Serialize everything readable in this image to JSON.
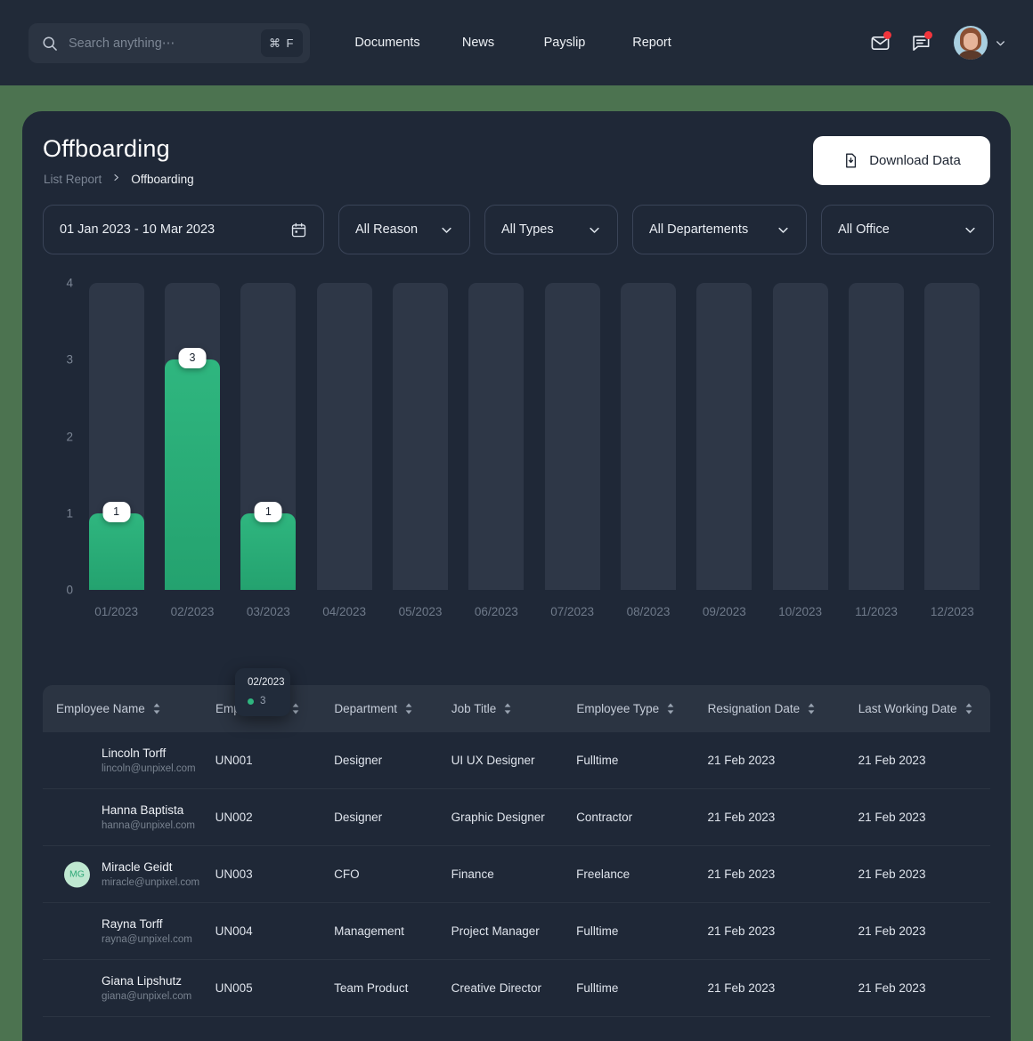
{
  "topbar": {
    "search": {
      "placeholder": "Search anything⋯",
      "value": "",
      "icon": "search-icon",
      "shortcut": "⌘ F"
    },
    "nav": [
      {
        "label": "Documents",
        "name": "documents"
      },
      {
        "label": "News",
        "name": "news"
      },
      {
        "label": "Payslip",
        "name": "payslip"
      },
      {
        "label": "Report",
        "name": "report"
      }
    ],
    "actions": {
      "mail_icon": "mail-icon",
      "chat_icon": "chat-icon",
      "badge_color": "#f2353c",
      "avatar": "user-avatar",
      "chevron": "chevron-down-icon"
    }
  },
  "page": {
    "title": "Offboarding",
    "breadcrumb": {
      "parent": "List Report",
      "separator": "›",
      "current": "Offboarding"
    },
    "download_label": "Download Data",
    "download_icon": "file-download-icon"
  },
  "filters": {
    "date_range": {
      "label": "01 Jan 2023 - 10 Mar 2023",
      "icon": "calendar-icon"
    },
    "reason": {
      "label": "All Reason",
      "icon": "chevron-down-icon"
    },
    "types": {
      "label": "All Types",
      "icon": "chevron-down-icon"
    },
    "departments": {
      "label": "All Departements",
      "icon": "chevron-down-icon"
    },
    "office": {
      "label": "All Office",
      "icon": "chevron-down-icon"
    }
  },
  "chart_data": {
    "type": "bar",
    "title": "",
    "xlabel": "",
    "ylabel": "",
    "categories": [
      "01/2023",
      "02/2023",
      "03/2023",
      "04/2023",
      "05/2023",
      "06/2023",
      "07/2023",
      "08/2023",
      "09/2023",
      "10/2023",
      "11/2023",
      "12/2023"
    ],
    "values": [
      1,
      3,
      1,
      0,
      0,
      0,
      0,
      0,
      0,
      0,
      0,
      0
    ],
    "value_labels": [
      "1",
      "3",
      "1",
      "",
      "",
      "",
      "",
      "",
      "",
      "",
      "",
      ""
    ],
    "ylim": [
      0,
      4
    ],
    "yticks": [
      "0",
      "1",
      "2",
      "3",
      "4"
    ],
    "grid": false,
    "legend": "none",
    "bar_color": "#2fb67f",
    "track_color": "#2e3747",
    "tooltip": {
      "title": "02/2023",
      "value": "3",
      "dot_color": "#2fb67f"
    }
  },
  "table": {
    "columns": [
      {
        "label": "Employee Name",
        "key": "name"
      },
      {
        "label": "Employee ID",
        "key": "id"
      },
      {
        "label": "Department",
        "key": "dept"
      },
      {
        "label": "Job Title",
        "key": "job"
      },
      {
        "label": "Employee Type",
        "key": "type"
      },
      {
        "label": "Resignation Date",
        "key": "resignation"
      },
      {
        "label": "Last Working Date",
        "key": "last"
      }
    ],
    "rows": [
      {
        "name": "Lincoln Torff",
        "email": "lincoln@unpixel.com",
        "initials": "",
        "id": "UN001",
        "dept": "Designer",
        "job": "UI UX Designer",
        "type": "Fulltime",
        "resignation": "21 Feb 2023",
        "last": "21 Feb 2023"
      },
      {
        "name": "Hanna Baptista",
        "email": "hanna@unpixel.com",
        "initials": "",
        "id": "UN002",
        "dept": "Designer",
        "job": "Graphic Designer",
        "type": "Contractor",
        "resignation": "21 Feb 2023",
        "last": "21 Feb 2023"
      },
      {
        "name": "Miracle Geidt",
        "email": "miracle@unpixel.com",
        "initials": "MG",
        "id": "UN003",
        "dept": "CFO",
        "job": "Finance",
        "type": "Freelance",
        "resignation": "21 Feb 2023",
        "last": "21 Feb 2023"
      },
      {
        "name": "Rayna Torff",
        "email": "rayna@unpixel.com",
        "initials": "",
        "id": "UN004",
        "dept": "Management",
        "job": "Project Manager",
        "type": "Fulltime",
        "resignation": "21 Feb 2023",
        "last": "21 Feb 2023"
      },
      {
        "name": "Giana Lipshutz",
        "email": "giana@unpixel.com",
        "initials": "",
        "id": "UN005",
        "dept": "Team Product",
        "job": "Creative Director",
        "type": "Fulltime",
        "resignation": "21 Feb 2023",
        "last": "21 Feb 2023"
      }
    ]
  },
  "colors": {
    "page_background": "#4c7350",
    "surface": "#1f2837",
    "topbar": "#212a38",
    "accent": "#2fb67f",
    "danger": "#f2353c"
  }
}
